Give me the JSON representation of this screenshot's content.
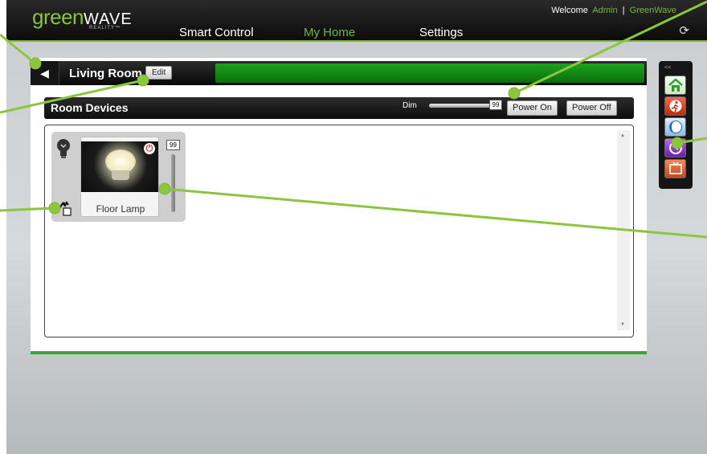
{
  "header": {
    "logo_main": "green",
    "logo_wave": "WAVE",
    "logo_sub": "REALITY™",
    "welcome_prefix": "Welcome",
    "user": "Admin",
    "separator": "|",
    "org": "GreenWave",
    "nav": [
      {
        "label": "Smart Control",
        "active": false
      },
      {
        "label": "My Home",
        "active": true
      },
      {
        "label": "Settings",
        "active": false
      }
    ]
  },
  "room": {
    "name": "Living Room",
    "edit_label": "Edit"
  },
  "devices": {
    "title": "Room Devices",
    "dim_label": "Dim",
    "dim_value": "99",
    "power_on_label": "Power On",
    "power_off_label": "Power Off",
    "items": [
      {
        "name": "Floor Lamp",
        "level": "99"
      }
    ]
  },
  "side_toolbar": {
    "collapse_glyph": "<<",
    "scenes": [
      "home-icon",
      "away-icon",
      "night-icon",
      "timer-icon",
      "tv-icon"
    ]
  },
  "colors": {
    "brand_green": "#7fb233",
    "status_green": "#1a9a1a",
    "power_red": "#e03030"
  }
}
